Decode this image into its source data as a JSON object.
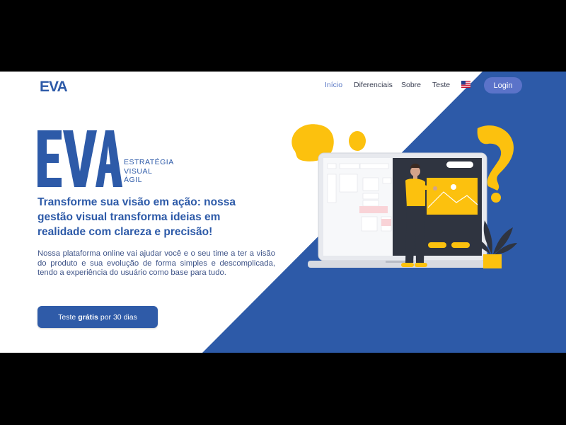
{
  "header": {
    "logo_text": "EVA",
    "nav": [
      {
        "label": "Início",
        "active": true
      },
      {
        "label": "Diferenciais",
        "active": false
      },
      {
        "label": "Sobre",
        "active": false
      },
      {
        "label": "Teste",
        "active": false
      }
    ],
    "language_flag": "us-flag-icon",
    "login_label": "Login"
  },
  "hero": {
    "logo_text": "EVA",
    "subtitle_lines": [
      "ESTRATÉGIA",
      "VISUAL",
      "ÁGIL"
    ],
    "headline": "Transforme sua visão em ação: nossa gestão visual transforma ideias em realidade com clareza e precisão!",
    "description": "Nossa plataforma online vai ajudar você e o seu time a ter a visão do produto e sua evolução de forma simples e descomplicada, tendo a experiência do usuário como base para tudo.",
    "cta": {
      "prefix": "Teste",
      "bold": "grátis",
      "suffix": "por 30 dias"
    }
  },
  "colors": {
    "brand_blue": "#2d5aa8",
    "accent_yellow": "#fcc10e",
    "login_button": "#5b73c9"
  }
}
